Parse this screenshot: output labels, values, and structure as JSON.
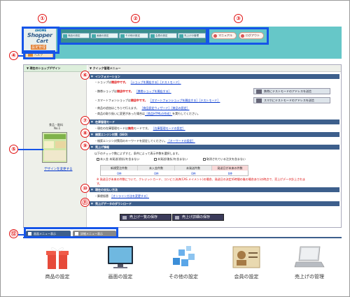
{
  "logo": {
    "home": "4HOME",
    "shopper": "Shopper",
    "cart": "Cart",
    "sub": "設定管理"
  },
  "nav_tabs": [
    "商品の設定",
    "画面の設定",
    "その他の設定",
    "会員の設定",
    "売上げの管理"
  ],
  "right_buttons": [
    "マニュアル",
    "ログアウト"
  ],
  "small_tab": "ヘルプ",
  "left_panel": {
    "title": "▼ 現在のショップデザイン",
    "category": "食品・飲料",
    "number": "No.1",
    "design_link": "デザインを変更する"
  },
  "quick_menu": {
    "title": "▼ クイック管理メニュー",
    "sections": {
      "info": "インフォメーション",
      "stock": "在庫管理モード",
      "seo": "検索エンジン対策（SEO）",
      "sales": "売上げ情報",
      "payment": "現在の支払い方法",
      "download": "売上げデータのダウンロード"
    },
    "info_lines": {
      "shop_status_pre": "・ショップは",
      "shop_status": "閉店中です。",
      "shop_link1": "［ショップを開店する］",
      "shop_link2": "［テストモード］",
      "mobile_pre": "・携帯ショップは",
      "mobile_status": "閉店中です。",
      "mobile_link": "［携帯ショップを開店する］",
      "smart_pre": "・スマートフォンショップは",
      "smart_status": "閉店中です。",
      "smart_link": "［スマートフォンショップを開店する］",
      "smart_link2": "［テストモード］",
      "product_pre": "・商品の追加はこちらで行えます。",
      "product_link1": "［商品設定ウィザード］",
      "product_link2": "［商品の設定］",
      "help_pre": "・商品の取り扱いに変更があった場合は",
      "help_link": "［商品HTMLの作成］",
      "help_post": "を実行してください。",
      "btn_mobile": "携帯にテストモードのアドレスを送信",
      "btn_smart": "スマホにテストモードのアドレスを送信"
    },
    "stock_line_pre": "・現在の在庫管理モードは",
    "stock_line_val": "無効",
    "stock_line_post": "モードです。",
    "stock_link": "［在庫管理モードの設定］",
    "seo_line": "・検索エンジン対策用のキーワードを設定してください。",
    "seo_link": "［キーワードの設定］",
    "sales_intro": "以下のチェック数によずすと、条件によって表示件数を選択します。",
    "checks": [
      "未入金 未発送(前払)を含まない",
      "未発送(後払)を含まない",
      "取消されている注文を含まない"
    ],
    "stats_headers": [
      "新規受注件数",
      "未入金件数",
      "未発送件数",
      "発送日が未来の件数"
    ],
    "stats_values": [
      "0件",
      "0件",
      "0件",
      "0件"
    ],
    "warning": "※ 発送日が未来の件数について、クレジットカード、コンビニ決済(CAS メイメント)の場合、発送日の決定(6時間の後の場合あり)の時点で、売上げデータ計上されます。",
    "payment_line": "・郵便振替",
    "payment_link": "［オンライン方法を変更する］",
    "download_btn1": "売上げ一覧の保存",
    "download_btn2": "売上げ詳細の保存"
  },
  "bottom_tabs": [
    "画面メニュー表示",
    "詳細メニュー表示"
  ],
  "menu_items": [
    "商品の設定",
    "画面の設定",
    "その他の設定",
    "会員の設定",
    "売上げの管理"
  ],
  "callouts": [
    "①",
    "②",
    "③",
    "④",
    "⑤",
    "⑥",
    "⑦",
    "⑧",
    "⑨",
    "⑩",
    "⑪",
    "⑫"
  ],
  "colors": {
    "callout_blue": "#1655e8",
    "callout_red": "#e01010",
    "section_bar": "#3d5f8c",
    "header_teal": "#66c7c8"
  }
}
